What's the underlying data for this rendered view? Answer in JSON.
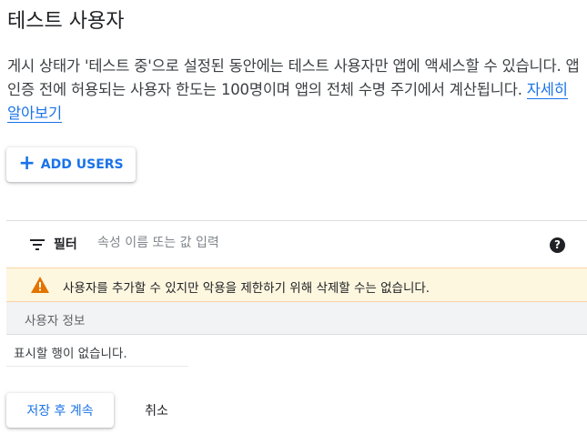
{
  "page": {
    "title": "테스트 사용자",
    "description": "게시 상태가 '테스트 중'으로 설정된 동안에는 테스트 사용자만 앱에 액세스할 수 있습니다. 앱 인증 전에 허용되는 사용자 한도는 100명이며 앱의 전체 수명 주기에서 계산됩니다. ",
    "learn_more_link": "자세히 알아보기"
  },
  "add_users_button": {
    "icon": "plus-icon",
    "label": "ADD USERS"
  },
  "filter": {
    "icon": "filter-list-icon",
    "label": "필터",
    "placeholder": "속성 이름 또는 값 입력",
    "help_icon": "help-icon",
    "help_glyph": "?"
  },
  "warning": {
    "icon": "warning-icon",
    "text": "사용자를 추가할 수 있지만 악용을 제한하기 위해 삭제할 수는 없습니다."
  },
  "table": {
    "columns": [
      "사용자 정보"
    ],
    "empty_message": "표시할 행이 없습니다."
  },
  "footer": {
    "save_label": "저장 후 계속",
    "cancel_label": "취소"
  },
  "colors": {
    "accent": "#1a73e8",
    "warning_bg": "#fef7e0",
    "warning_icon": "#e37400",
    "header_bg": "#f1f3f4"
  }
}
